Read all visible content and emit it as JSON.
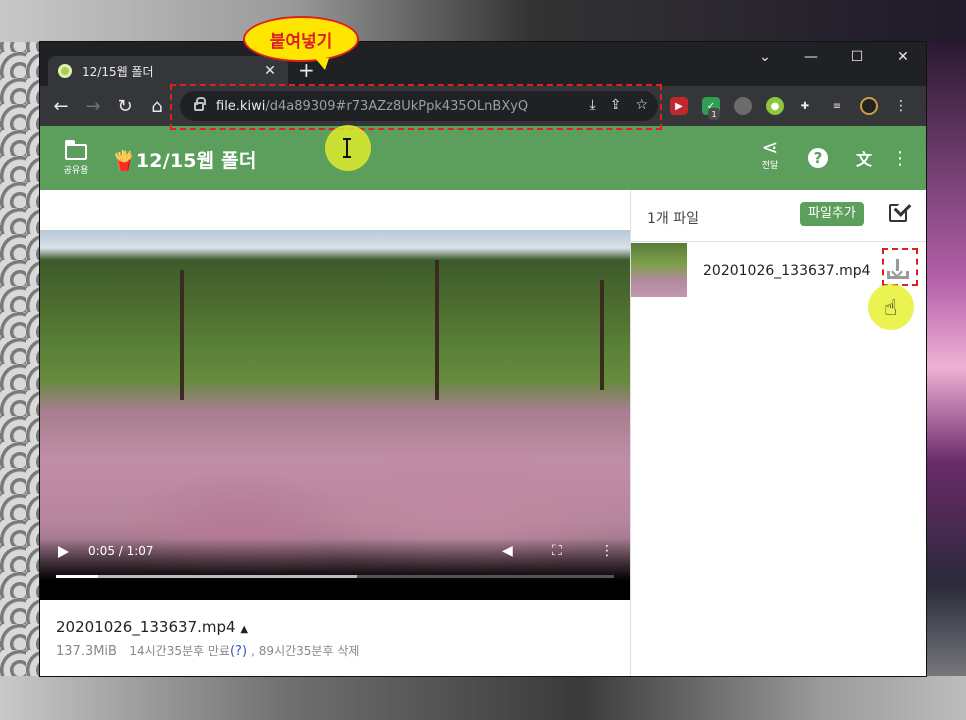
{
  "browser": {
    "tab_title": "12/15웹 폴더",
    "new_tab": "+",
    "url_host": "file.kiwi",
    "url_path": "/d4a89309#r73AZz8UkPpk435OLnBXyQ",
    "win_minimize": "—",
    "win_maximize": "☐",
    "win_close": "✕",
    "win_menu": "⌄",
    "ext_badge": "1"
  },
  "annotation": {
    "paste_bubble": "붙여넣기",
    "accent": "#e02020",
    "highlight": "#e6f028"
  },
  "app": {
    "shared_label": "공유용",
    "title": "12/15웹 폴더",
    "share_label": "전달",
    "help": "?",
    "brand_color": "#5c9e5c"
  },
  "video": {
    "time": "0:05 / 1:07",
    "progress_fraction": 0.075,
    "buffer_fraction": 0.54
  },
  "file": {
    "name": "20201026_133637.mp4",
    "size": "137.3MiB",
    "expire": "14시간35분후 만료",
    "help_link": "(?)",
    "delete": ", 89시간35분후 삭제"
  },
  "panel": {
    "count": "1개 파일",
    "add_button": "파일추가",
    "files": [
      {
        "name": "20201026_133637.mp4"
      }
    ]
  }
}
